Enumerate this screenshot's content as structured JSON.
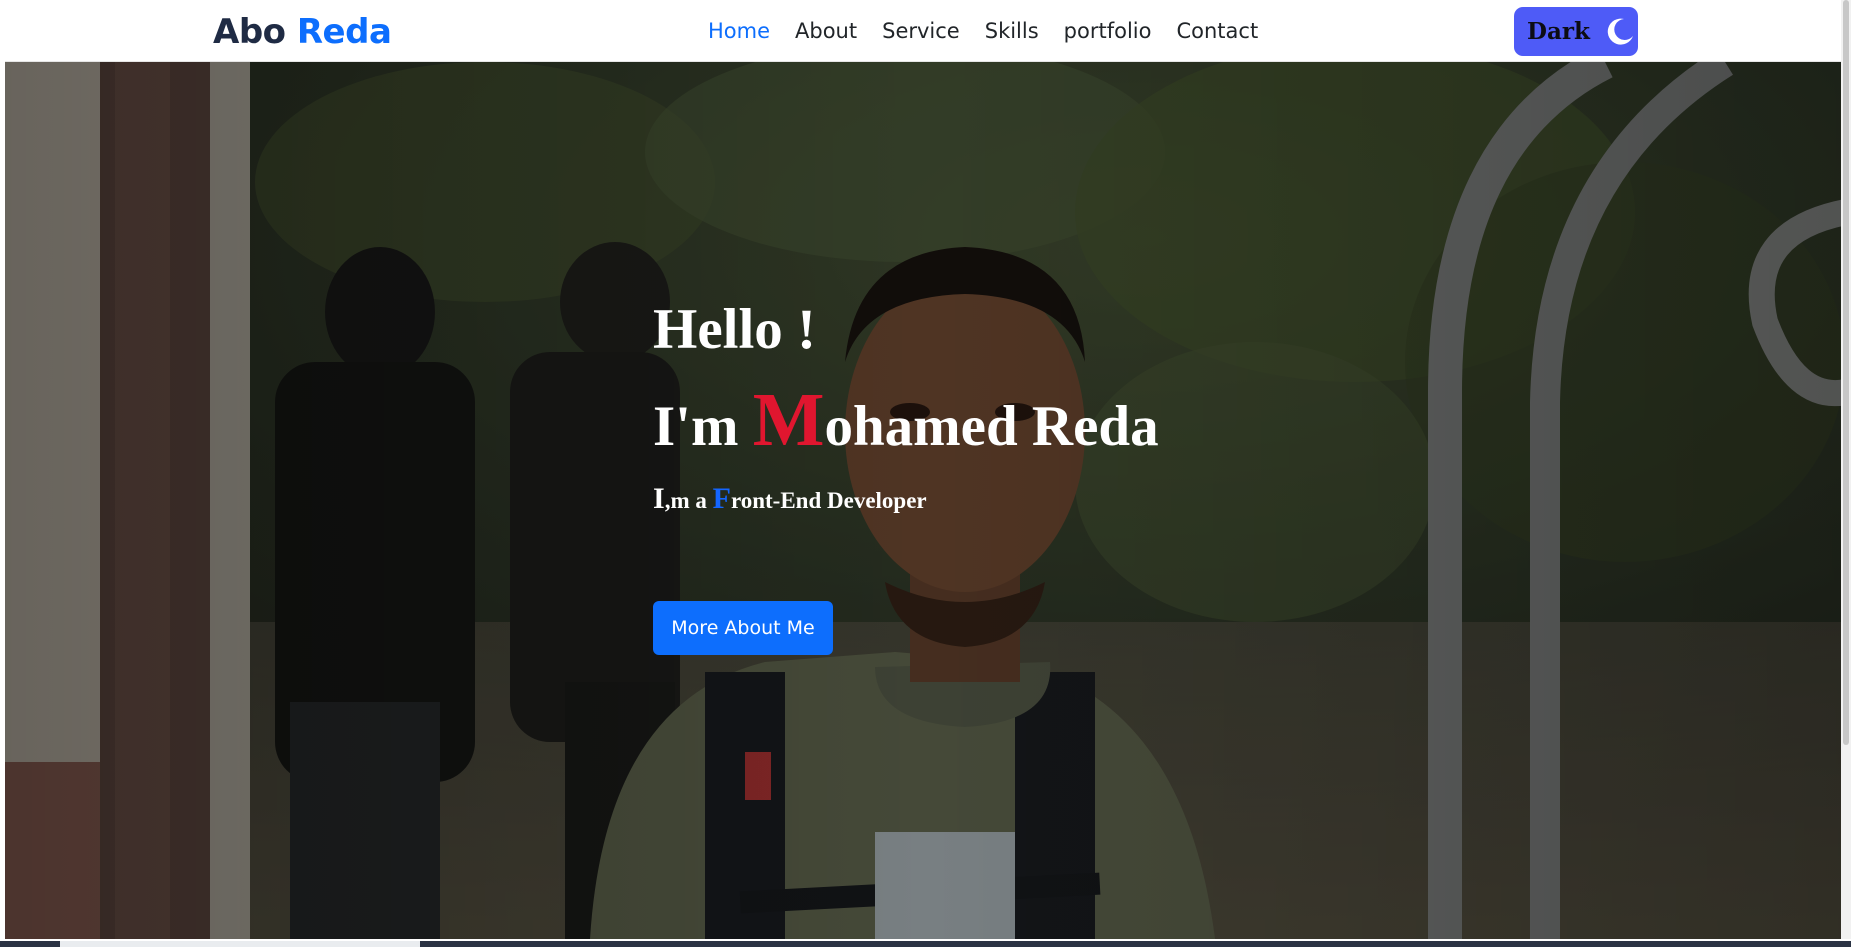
{
  "navbar": {
    "brand_first": "Abo",
    "brand_second": "Reda",
    "links": [
      {
        "label": "Home",
        "active": true
      },
      {
        "label": "About",
        "active": false
      },
      {
        "label": "Service",
        "active": false
      },
      {
        "label": "Skills",
        "active": false
      },
      {
        "label": "portfolio",
        "active": false
      },
      {
        "label": "Contact",
        "active": false
      }
    ],
    "theme_toggle_label": "Dark",
    "theme_toggle_icon": "moon-icon"
  },
  "hero": {
    "greeting": "Hello !",
    "name_prefix": "I'm ",
    "name_initial": "M",
    "name_rest": "ohamed Reda",
    "role_first": "I",
    "role_mid": ",m a ",
    "role_initial": "F",
    "role_rest": "ront-End Developer",
    "cta_label": "More About Me"
  },
  "colors": {
    "brand_accent": "#0d6efd",
    "brand_dark": "#1f2b44",
    "toggle_bg": "#4e5bf7",
    "name_initial": "#e0162f",
    "role_initial": "#1466ff",
    "button_bg": "#0d6efd"
  }
}
